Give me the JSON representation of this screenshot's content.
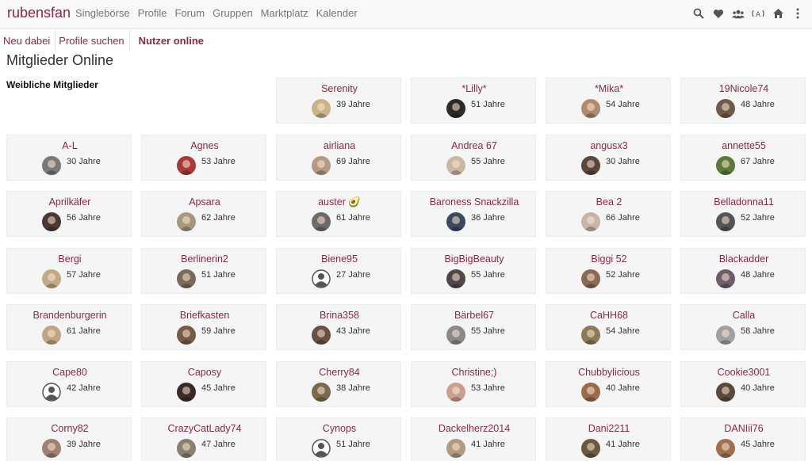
{
  "brand": "rubensfan",
  "nav": [
    "Singlebörse",
    "Profile",
    "Forum",
    "Gruppen",
    "Marktplatz",
    "Kalender"
  ],
  "header_icons": [
    "search-icon",
    "heart-icon",
    "group-icon",
    "broadcast-icon",
    "home-icon",
    "more-vertical-icon"
  ],
  "subnav": [
    {
      "label": "Neu dabei",
      "active": false
    },
    {
      "label": "Profile suchen",
      "active": false
    },
    {
      "label": "Nutzer online",
      "active": true
    }
  ],
  "page_title": "Mitglieder Online",
  "section_title": "Weibliche Mitglieder",
  "members": [
    {
      "name": "Serenity",
      "age": "39 Jahre",
      "avatar_color": "#c9b48a",
      "placeholder": false
    },
    {
      "name": "*Lilly*",
      "age": "51 Jahre",
      "avatar_color": "#2b2b2b",
      "placeholder": false
    },
    {
      "name": "*Mika*",
      "age": "54 Jahre",
      "avatar_color": "#b08a6c",
      "placeholder": false
    },
    {
      "name": "19Nicole74",
      "age": "48 Jahre",
      "avatar_color": "#6e5a48",
      "placeholder": false
    },
    {
      "name": "A-L",
      "age": "30 Jahre",
      "avatar_color": "#7a7a7a",
      "placeholder": false
    },
    {
      "name": "Agnes",
      "age": "53 Jahre",
      "avatar_color": "#a83a3a",
      "placeholder": false
    },
    {
      "name": "airliana",
      "age": "69 Jahre",
      "avatar_color": "#b39a86",
      "placeholder": false
    },
    {
      "name": "Andrea 67",
      "age": "55 Jahre",
      "avatar_color": "#c7b9a2",
      "placeholder": false
    },
    {
      "name": "angusx3",
      "age": "30 Jahre",
      "avatar_color": "#5a463c",
      "placeholder": false
    },
    {
      "name": "annette55",
      "age": "67 Jahre",
      "avatar_color": "#5b7a3c",
      "placeholder": false
    },
    {
      "name": "Aprilkäfer",
      "age": "56 Jahre",
      "avatar_color": "#4a3a33",
      "placeholder": false
    },
    {
      "name": "Apsara",
      "age": "62 Jahre",
      "avatar_color": "#a99880",
      "placeholder": false
    },
    {
      "name": "auster 🥑",
      "age": "61 Jahre",
      "avatar_color": "#6b6b6b",
      "placeholder": false
    },
    {
      "name": "Baroness Snackzilla",
      "age": "36 Jahre",
      "avatar_color": "#3a4a5c",
      "placeholder": false
    },
    {
      "name": "Bea 2",
      "age": "66 Jahre",
      "avatar_color": "#c8b4a8",
      "placeholder": false
    },
    {
      "name": "Belladonna11",
      "age": "52 Jahre",
      "avatar_color": "#555555",
      "placeholder": false
    },
    {
      "name": "Bergi",
      "age": "57 Jahre",
      "avatar_color": "#c2a98a",
      "placeholder": false
    },
    {
      "name": "Berlinerin2",
      "age": "51 Jahre",
      "avatar_color": "#7a6a5a",
      "placeholder": false
    },
    {
      "name": "Biene95",
      "age": "27 Jahre",
      "avatar_color": "#dddddd",
      "placeholder": true
    },
    {
      "name": "BigBigBeauty",
      "age": "55 Jahre",
      "avatar_color": "#4f4a4a",
      "placeholder": false
    },
    {
      "name": "Biggi 52",
      "age": "52 Jahre",
      "avatar_color": "#8a6a55",
      "placeholder": false
    },
    {
      "name": "Blackadder",
      "age": "48 Jahre",
      "avatar_color": "#6e5e6a",
      "placeholder": false
    },
    {
      "name": "Brandenburgerin",
      "age": "61 Jahre",
      "avatar_color": "#c0a584",
      "placeholder": false
    },
    {
      "name": "Briefkasten",
      "age": "59 Jahre",
      "avatar_color": "#7a5a45",
      "placeholder": false
    },
    {
      "name": "Brina358",
      "age": "43 Jahre",
      "avatar_color": "#6a5040",
      "placeholder": false
    },
    {
      "name": "Bärbel67",
      "age": "55 Jahre",
      "avatar_color": "#8a8a8a",
      "placeholder": false
    },
    {
      "name": "CaHH68",
      "age": "54 Jahre",
      "avatar_color": "#8a7a55",
      "placeholder": false
    },
    {
      "name": "Calla",
      "age": "58 Jahre",
      "avatar_color": "#a0a0a0",
      "placeholder": false
    },
    {
      "name": "Cape80",
      "age": "42 Jahre",
      "avatar_color": "#dddddd",
      "placeholder": true
    },
    {
      "name": "Caposy",
      "age": "45 Jahre",
      "avatar_color": "#3a2a2a",
      "placeholder": false
    },
    {
      "name": "Cherry84",
      "age": "38 Jahre",
      "avatar_color": "#7a6a4a",
      "placeholder": false
    },
    {
      "name": "Christine;)",
      "age": "53 Jahre",
      "avatar_color": "#c8a090",
      "placeholder": false
    },
    {
      "name": "Chubbylicious",
      "age": "40 Jahre",
      "avatar_color": "#9a6a4a",
      "placeholder": false
    },
    {
      "name": "Cookie3001",
      "age": "40 Jahre",
      "avatar_color": "#5a4a3a",
      "placeholder": false
    },
    {
      "name": "Corny82",
      "age": "39 Jahre",
      "avatar_color": "#a08070",
      "placeholder": false
    },
    {
      "name": "CrazyCatLady74",
      "age": "47 Jahre",
      "avatar_color": "#8a8070",
      "placeholder": false
    },
    {
      "name": "Cynops",
      "age": "51 Jahre",
      "avatar_color": "#dddddd",
      "placeholder": true
    },
    {
      "name": "Dackelherz2014",
      "age": "41 Jahre",
      "avatar_color": "#b09a80",
      "placeholder": false
    },
    {
      "name": "Dani2211",
      "age": "41 Jahre",
      "avatar_color": "#6a5a40",
      "placeholder": false
    },
    {
      "name": "DANIii76",
      "age": "45 Jahre",
      "avatar_color": "#a07050",
      "placeholder": false
    }
  ]
}
